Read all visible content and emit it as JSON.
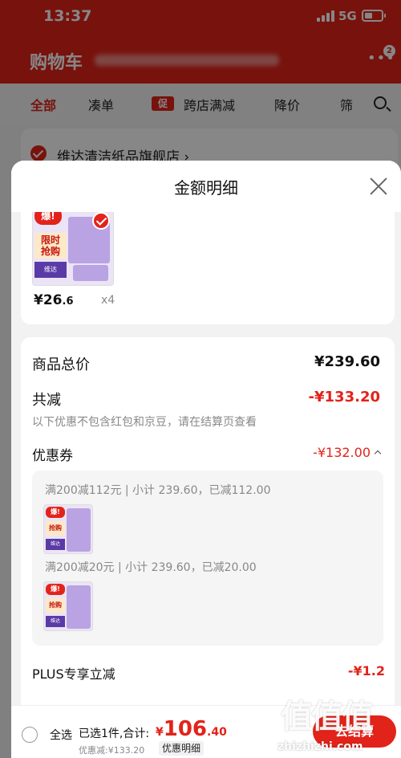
{
  "status_bar": {
    "time": "13:37",
    "network": "5G"
  },
  "background": {
    "title": "购物车",
    "badge": "2",
    "filters": [
      "全部",
      "凑单",
      "跨店满减",
      "降价",
      "筛"
    ],
    "promo_tag": "促",
    "store_name": "维达清洁纸品旗舰店 ›"
  },
  "sheet": {
    "title": "金额明细",
    "product": {
      "burst": "爆!",
      "badge": "抢购",
      "ribbon": "限时",
      "price_int": "¥26",
      "price_dec": ".6",
      "qty": "x4"
    },
    "rows": {
      "goods_total_label": "商品总价",
      "goods_total_value": "¥239.60",
      "discount_label": "共减",
      "discount_value": "-¥133.20",
      "discount_note": "以下优惠不包含红包和京豆，请在结算页查看",
      "coupon_label": "优惠券",
      "coupon_value": "-¥132.00",
      "coupon_lines": [
        "满200减112元 | 小计 239.60，已减112.00",
        "满200减20元 | 小计 239.60，已减20.00"
      ],
      "plus_label": "PLUS专享立减",
      "plus_value": "-¥1.2"
    }
  },
  "bottom_bar": {
    "select_all": "全选",
    "selected": "已选1件,合计:",
    "total_currency": "¥",
    "total_int": "106",
    "total_dec": ".40",
    "saved": "优惠减:¥133.20",
    "detail_button": "优惠明细",
    "pay_button": "去结算"
  },
  "watermark": {
    "text": "值值值",
    "url": "zhizhizhi.com"
  },
  "colors": {
    "accent": "#e2231a",
    "muted": "#888888"
  }
}
